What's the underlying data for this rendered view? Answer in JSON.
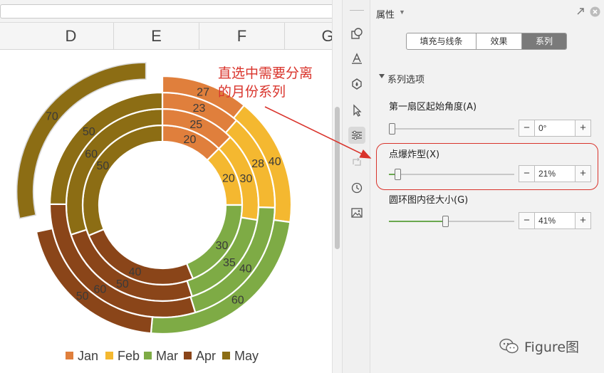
{
  "spreadsheet": {
    "columns": [
      "D",
      "E",
      "F",
      "G"
    ]
  },
  "annotation": {
    "text": "直选中需要分离的月份系列",
    "color": "#d9332b"
  },
  "chart_data": {
    "type": "doughnut",
    "rings_inner_to_outer": [
      "Jan",
      "Feb",
      "Mar",
      "Apr",
      "May"
    ],
    "categories": [
      "Jan",
      "Feb",
      "Mar",
      "Apr",
      "May"
    ],
    "series": [
      {
        "values": [
          20,
          20,
          30,
          40,
          50
        ]
      },
      {
        "values": [
          25,
          30,
          35,
          50,
          60
        ]
      },
      {
        "values": [
          23,
          28,
          40,
          60,
          50
        ]
      },
      {
        "values": [
          27,
          40,
          60,
          50,
          70
        ]
      }
    ],
    "exploded": {
      "series": 3,
      "point": 4
    },
    "colors": [
      "#e07f3c",
      "#f4b830",
      "#7eab45",
      "#8a4519",
      "#8c6d14"
    ],
    "legend": {
      "position": "bottom",
      "entries": [
        "Jan",
        "Feb",
        "Mar",
        "Apr",
        "May"
      ]
    }
  },
  "panel": {
    "title": "属性",
    "tabs": [
      "填充与线条",
      "效果",
      "系列"
    ],
    "active_tab": 2,
    "section_title": "系列选项",
    "fields": [
      {
        "label": "第一扇区起始角度(A)",
        "value": "0°",
        "level": 0.02
      },
      {
        "label": "点爆炸型(X)",
        "value": "21%",
        "level": 0.07
      },
      {
        "label": "圆环图内径大小(G)",
        "value": "41%",
        "level": 0.45
      }
    ],
    "minus": "−",
    "plus": "+"
  },
  "watermark": {
    "text": "Figure图"
  },
  "icons": [
    "shape-icon",
    "text-style-icon",
    "fill-drop-icon",
    "cursor-icon",
    "series-options-icon",
    "rotate-icon",
    "history-icon",
    "image-icon",
    "pin-icon",
    "close-icon",
    "wechat-icon"
  ]
}
